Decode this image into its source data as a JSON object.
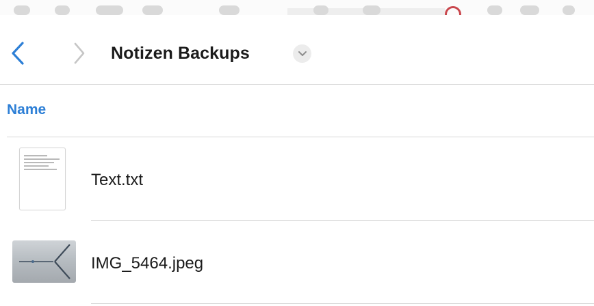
{
  "navigation": {
    "back_icon": "chevron-left-icon",
    "forward_icon": "chevron-right-icon",
    "title": "Notizen Backups",
    "title_menu_icon": "chevron-down-icon"
  },
  "list": {
    "sort_column_label": "Name",
    "files": [
      {
        "name": "Text.txt",
        "thumbnail": "text-document-icon"
      },
      {
        "name": "IMG_5464.jpeg",
        "thumbnail": "image-thumbnail"
      }
    ]
  },
  "colors": {
    "accent": "#2d7fd6",
    "divider": "#d6d6d6",
    "text": "#1b1b1b"
  }
}
